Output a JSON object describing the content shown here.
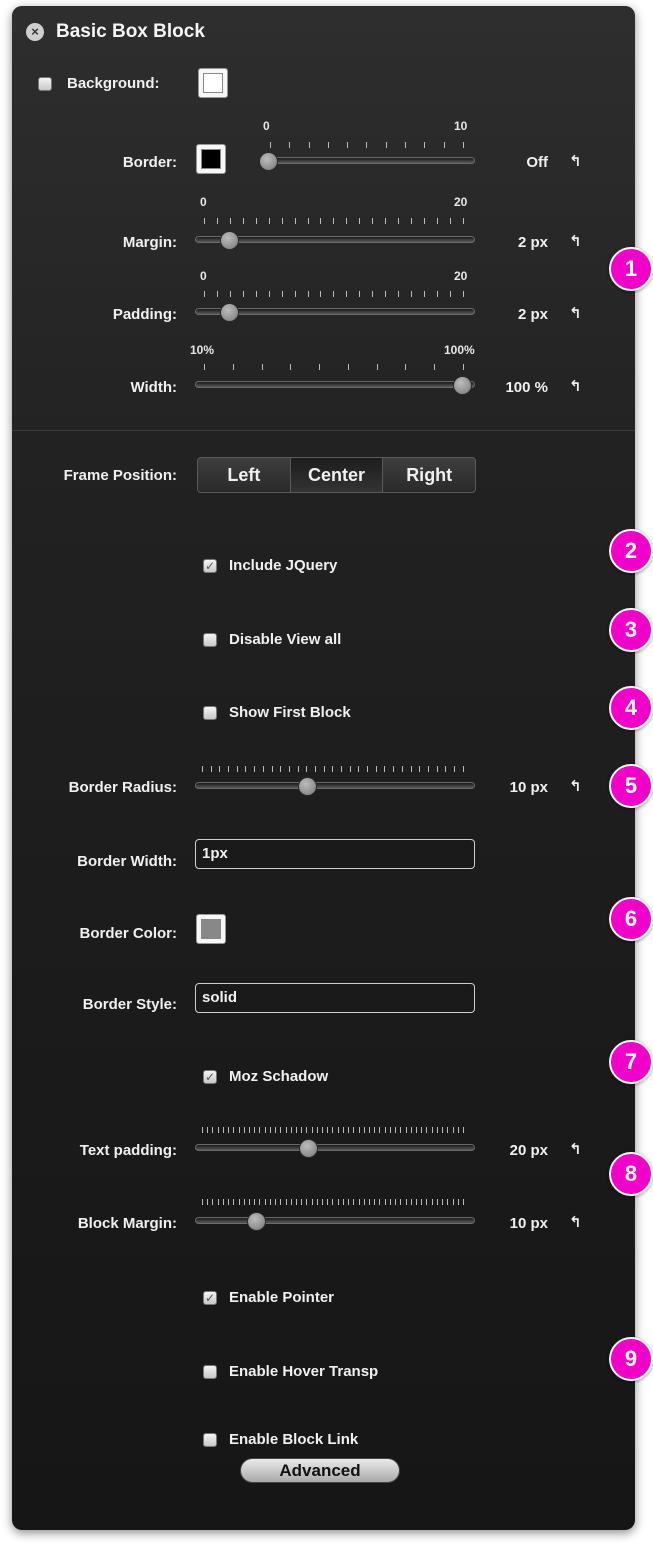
{
  "panel": {
    "title": "Basic Box Block"
  },
  "top": {
    "background_label": "Background:",
    "border_label": "Border:",
    "border_min": "0",
    "border_max": "10",
    "border_value": "Off",
    "margin_label": "Margin:",
    "margin_min": "0",
    "margin_max": "20",
    "margin_value": "2 px",
    "padding_label": "Padding:",
    "padding_min": "0",
    "padding_max": "20",
    "padding_value": "2 px",
    "width_label": "Width:",
    "width_min": "10%",
    "width_max": "100%",
    "width_value": "100 %"
  },
  "frame": {
    "label": "Frame Position:",
    "options": [
      "Left",
      "Center",
      "Right"
    ],
    "selected": "Center"
  },
  "checks": {
    "include_jquery": "Include JQuery",
    "disable_view_all": "Disable View all",
    "show_first_block": "Show First Block",
    "moz_shadow": "Moz Schadow",
    "enable_pointer": "Enable Pointer",
    "enable_hover_transp": "Enable Hover Transp",
    "enable_block_link": "Enable Block Link"
  },
  "fields": {
    "border_radius_label": "Border Radius:",
    "border_radius_value": "10 px",
    "border_width_label": "Border Width:",
    "border_width_value": "1px",
    "border_color_label": "Border Color:",
    "border_style_label": "Border Style:",
    "border_style_value": "solid",
    "text_padding_label": "Text padding:",
    "text_padding_value": "20 px",
    "block_margin_label": "Block Margin:",
    "block_margin_value": "10 px"
  },
  "advanced_label": "Advanced",
  "badges": [
    "1",
    "2",
    "3",
    "4",
    "5",
    "6",
    "7",
    "8",
    "9"
  ],
  "colors": {
    "badge": "#f000c8",
    "panel": "#222222",
    "border_swatch": "#000000",
    "border_color_swatch": "#888888"
  }
}
